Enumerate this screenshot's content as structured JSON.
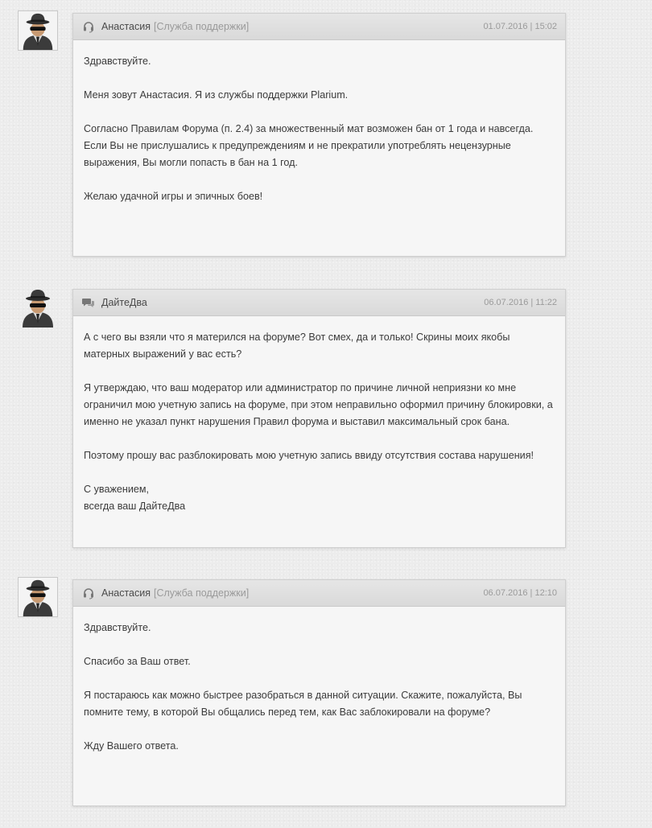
{
  "messages": [
    {
      "author": "Анастасия",
      "role": "[Служба поддержки]",
      "author_icon": "headset-icon",
      "timestamp": "01.07.2016 | 15:02",
      "paragraphs": [
        "Здравствуйте.",
        "Меня зовут Анастасия. Я из службы поддержки Plarium.",
        "Согласно Правилам Форума (п. 2.4) за множественный мат возможен бан от 1 года и навсегда. Если Вы не прислушались к предупреждениям и не прекратили употреблять нецензурные выражения, Вы могли попасть в бан на 1 год.",
        "Желаю удачной игры и эпичных боев!"
      ]
    },
    {
      "author": "ДайтеДва",
      "role": "",
      "author_icon": "chat-bubbles-icon",
      "timestamp": "06.07.2016 | 11:22",
      "paragraphs": [
        "А с чего вы взяли что я матерился на форуме? Вот смех, да и только! Скрины моих якобы матерных выражений у вас есть?",
        "Я утверждаю, что ваш модератор или администратор по причине личной неприязни ко мне ограничил мою учетную запись на форуме, при этом неправильно оформил причину блокировки, а именно не указал пункт нарушения Правил форума и выставил максимальный срок бана.",
        "Поэтому прошу вас разблокировать мою учетную запись ввиду отсутствия состава нарушения!",
        "С уважением,\nвсегда ваш ДайтеДва"
      ]
    },
    {
      "author": "Анастасия",
      "role": "[Служба поддержки]",
      "author_icon": "headset-icon",
      "timestamp": "06.07.2016 | 12:10",
      "paragraphs": [
        "Здравствуйте.",
        "Спасибо за Ваш ответ.",
        "Я постараюсь как можно быстрее разобраться в данной ситуации. Скажите, пожалуйста, Вы помните тему, в которой Вы общались перед тем, как Вас заблокировали на форуме?",
        "Жду Вашего ответа."
      ]
    }
  ]
}
